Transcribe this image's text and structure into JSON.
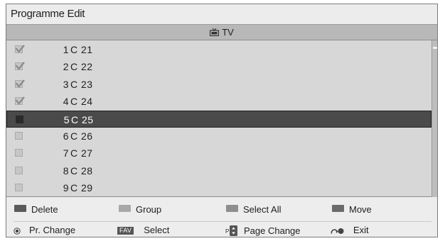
{
  "window": {
    "title": "Programme Edit"
  },
  "list": {
    "header_label": "TV",
    "header_icon": "tv-icon",
    "rows": [
      {
        "number": "1",
        "name": "C 21",
        "checked": true,
        "selected": false
      },
      {
        "number": "2",
        "name": "C 22",
        "checked": true,
        "selected": false
      },
      {
        "number": "3",
        "name": "C 23",
        "checked": true,
        "selected": false
      },
      {
        "number": "4",
        "name": "C 24",
        "checked": true,
        "selected": false
      },
      {
        "number": "5",
        "name": "C 25",
        "checked": false,
        "selected": true
      },
      {
        "number": "6",
        "name": "C 26",
        "checked": false,
        "selected": false
      },
      {
        "number": "7",
        "name": "C 27",
        "checked": false,
        "selected": false
      },
      {
        "number": "8",
        "name": "C 28",
        "checked": false,
        "selected": false
      },
      {
        "number": "9",
        "name": "C 29",
        "checked": false,
        "selected": false
      }
    ]
  },
  "color_buttons": [
    {
      "label": "Delete",
      "color": "#5a5a5a"
    },
    {
      "label": "Group",
      "color": "#a8a8a8"
    },
    {
      "label": "Select All",
      "color": "#8e8e8e"
    },
    {
      "label": "Move",
      "color": "#6a6a6a"
    }
  ],
  "hints": {
    "pr_change": "Pr. Change",
    "fav_badge": "FAV",
    "select": "Select",
    "page_change": "Page Change",
    "exit": "Exit",
    "icons": [
      "ok-icon",
      "fav-icon",
      "page-up-down-icon",
      "return-icon"
    ]
  },
  "colors": {
    "selected_row": "#4a4a4a",
    "list_bg": "#d7d7d7",
    "header_bg": "#b8b8b8",
    "panel_bg": "#ededed"
  }
}
